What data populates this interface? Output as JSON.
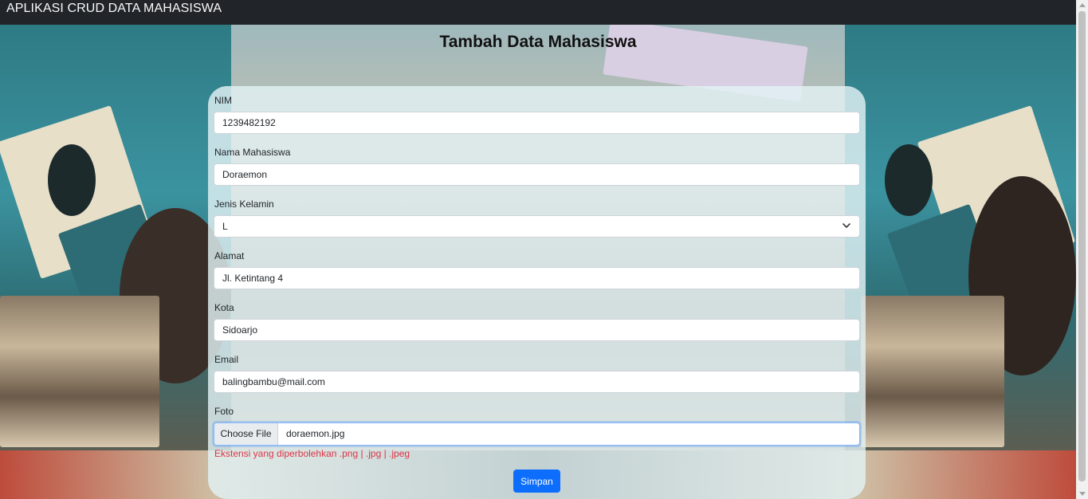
{
  "navbar": {
    "brand": "APLIKASI CRUD DATA MAHASISWA"
  },
  "page": {
    "title": "Tambah Data Mahasiswa"
  },
  "form": {
    "nim": {
      "label": "NIM",
      "value": "1239482192"
    },
    "nama": {
      "label": "Nama Mahasiswa",
      "value": "Doraemon"
    },
    "jenis_kelamin": {
      "label": "Jenis Kelamin",
      "value": "L"
    },
    "alamat": {
      "label": "Alamat",
      "value": "Jl. Ketintang 4"
    },
    "kota": {
      "label": "Kota",
      "value": "Sidoarjo"
    },
    "email": {
      "label": "Email",
      "value": "balingbambu@mail.com"
    },
    "foto": {
      "label": "Foto",
      "button_label": "Choose File",
      "file_name": "doraemon.jpg",
      "hint": "Ekstensi yang diperbolehkan .png | .jpg | .jpeg"
    },
    "submit_label": "Simpan"
  },
  "colors": {
    "navbar_bg": "#212529",
    "primary": "#0d6efd",
    "danger": "#dc3545"
  },
  "icons": {
    "select": "chevron-down-icon"
  }
}
